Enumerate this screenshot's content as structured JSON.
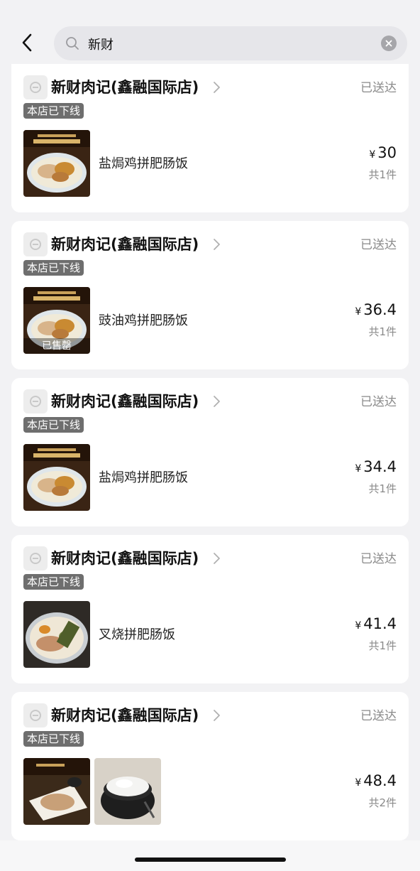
{
  "search": {
    "query": "新财"
  },
  "orders": [
    {
      "shop_name": "新财肉记(鑫融国际店)",
      "status": "已送达",
      "badge": "本店已下线",
      "item_name": "盐焗鸡拼肥肠饭",
      "currency": "¥",
      "price": "30",
      "count": "共1件",
      "sold_out": ""
    },
    {
      "shop_name": "新财肉记(鑫融国际店)",
      "status": "已送达",
      "badge": "本店已下线",
      "item_name": "豉油鸡拼肥肠饭",
      "currency": "¥",
      "price": "36.4",
      "count": "共1件",
      "sold_out": "已售罄"
    },
    {
      "shop_name": "新财肉记(鑫融国际店)",
      "status": "已送达",
      "badge": "本店已下线",
      "item_name": "盐焗鸡拼肥肠饭",
      "currency": "¥",
      "price": "34.4",
      "count": "共1件",
      "sold_out": ""
    },
    {
      "shop_name": "新财肉记(鑫融国际店)",
      "status": "已送达",
      "badge": "本店已下线",
      "item_name": "叉烧拼肥肠饭",
      "currency": "¥",
      "price": "41.4",
      "count": "共1件",
      "sold_out": ""
    },
    {
      "shop_name": "新财肉记(鑫融国际店)",
      "status": "已送达",
      "badge": "本店已下线",
      "item_name": "",
      "currency": "¥",
      "price": "48.4",
      "count": "共2件",
      "sold_out": ""
    }
  ],
  "icons": {
    "back": "chevron-left-icon",
    "search": "search-icon",
    "clear": "clear-icon",
    "shop_logo": "shop-logo-icon",
    "shop_arrow": "chevron-right-icon"
  },
  "colors": {
    "background": "#f2f2f4",
    "card": "#ffffff",
    "badge": "#6e6e6e",
    "muted_text": "#8a8a8a"
  }
}
